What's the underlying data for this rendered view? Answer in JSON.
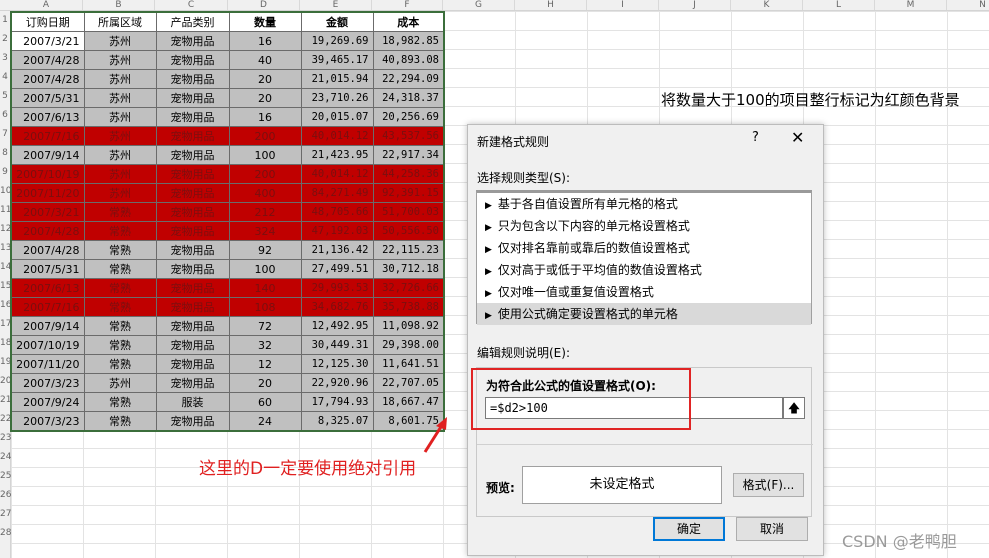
{
  "columns": [
    "A",
    "B",
    "C",
    "D",
    "E",
    "F",
    "G",
    "H",
    "I",
    "J",
    "K",
    "L",
    "M",
    "N"
  ],
  "rows": [
    "1",
    "2",
    "3",
    "4",
    "5",
    "6",
    "7",
    "8",
    "9",
    "10",
    "11",
    "12",
    "13",
    "14",
    "15",
    "16",
    "17",
    "18",
    "19",
    "20",
    "21",
    "22",
    "23",
    "24",
    "25",
    "26",
    "27",
    "28"
  ],
  "table": {
    "headers": [
      "订购日期",
      "所属区域",
      "产品类别",
      "数量",
      "金额",
      "成本"
    ],
    "records": [
      {
        "date": "2007/3/21",
        "region": "苏州",
        "category": "宠物用品",
        "qty": "16",
        "amount": "19,269.69",
        "cost": "18,982.85",
        "hl": false
      },
      {
        "date": "2007/4/28",
        "region": "苏州",
        "category": "宠物用品",
        "qty": "40",
        "amount": "39,465.17",
        "cost": "40,893.08",
        "hl": false
      },
      {
        "date": "2007/4/28",
        "region": "苏州",
        "category": "宠物用品",
        "qty": "20",
        "amount": "21,015.94",
        "cost": "22,294.09",
        "hl": false
      },
      {
        "date": "2007/5/31",
        "region": "苏州",
        "category": "宠物用品",
        "qty": "20",
        "amount": "23,710.26",
        "cost": "24,318.37",
        "hl": false
      },
      {
        "date": "2007/6/13",
        "region": "苏州",
        "category": "宠物用品",
        "qty": "16",
        "amount": "20,015.07",
        "cost": "20,256.69",
        "hl": false
      },
      {
        "date": "2007/7/16",
        "region": "苏州",
        "category": "宠物用品",
        "qty": "200",
        "amount": "40,014.12",
        "cost": "43,537.56",
        "hl": true
      },
      {
        "date": "2007/9/14",
        "region": "苏州",
        "category": "宠物用品",
        "qty": "100",
        "amount": "21,423.95",
        "cost": "22,917.34",
        "hl": false
      },
      {
        "date": "2007/10/19",
        "region": "苏州",
        "category": "宠物用品",
        "qty": "200",
        "amount": "40,014.12",
        "cost": "44,258.36",
        "hl": true
      },
      {
        "date": "2007/11/20",
        "region": "苏州",
        "category": "宠物用品",
        "qty": "400",
        "amount": "84,271.49",
        "cost": "92,391.15",
        "hl": true
      },
      {
        "date": "2007/3/21",
        "region": "常熟",
        "category": "宠物用品",
        "qty": "212",
        "amount": "48,705.66",
        "cost": "51,700.03",
        "hl": true
      },
      {
        "date": "2007/4/28",
        "region": "常熟",
        "category": "宠物用品",
        "qty": "324",
        "amount": "47,192.03",
        "cost": "50,556.50",
        "hl": true
      },
      {
        "date": "2007/4/28",
        "region": "常熟",
        "category": "宠物用品",
        "qty": "92",
        "amount": "21,136.42",
        "cost": "22,115.23",
        "hl": false
      },
      {
        "date": "2007/5/31",
        "region": "常熟",
        "category": "宠物用品",
        "qty": "100",
        "amount": "27,499.51",
        "cost": "30,712.18",
        "hl": false
      },
      {
        "date": "2007/6/13",
        "region": "常熟",
        "category": "宠物用品",
        "qty": "140",
        "amount": "29,993.53",
        "cost": "32,726.66",
        "hl": true
      },
      {
        "date": "2007/7/16",
        "region": "常熟",
        "category": "宠物用品",
        "qty": "108",
        "amount": "34,682.76",
        "cost": "35,738.88",
        "hl": true
      },
      {
        "date": "2007/9/14",
        "region": "常熟",
        "category": "宠物用品",
        "qty": "72",
        "amount": "12,492.95",
        "cost": "11,098.92",
        "hl": false
      },
      {
        "date": "2007/10/19",
        "region": "常熟",
        "category": "宠物用品",
        "qty": "32",
        "amount": "30,449.31",
        "cost": "29,398.00",
        "hl": false
      },
      {
        "date": "2007/11/20",
        "region": "常熟",
        "category": "宠物用品",
        "qty": "12",
        "amount": "12,125.30",
        "cost": "11,641.51",
        "hl": false
      },
      {
        "date": "2007/3/23",
        "region": "苏州",
        "category": "宠物用品",
        "qty": "20",
        "amount": "22,920.96",
        "cost": "22,707.05",
        "hl": false
      },
      {
        "date": "2007/9/24",
        "region": "常熟",
        "category": "服装",
        "qty": "60",
        "amount": "17,794.93",
        "cost": "18,667.47",
        "hl": false
      },
      {
        "date": "2007/3/23",
        "region": "常熟",
        "category": "宠物用品",
        "qty": "24",
        "amount": "8,325.07",
        "cost": "8,601.75",
        "hl": false
      }
    ]
  },
  "note": "将数量大于100的项目整行标记为红颜色背景",
  "caption": "这里的D一定要使用绝对引用",
  "dialog": {
    "title": "新建格式规则",
    "help": "?",
    "close": "✕",
    "rule_type_label": "选择规则类型(S):",
    "rules": [
      "基于各自值设置所有单元格的格式",
      "只为包含以下内容的单元格设置格式",
      "仅对排名靠前或靠后的数值设置格式",
      "仅对高于或低于平均值的数值设置格式",
      "仅对唯一值或重复值设置格式",
      "使用公式确定要设置格式的单元格"
    ],
    "selected_rule": 5,
    "edit_label": "编辑规则说明(E):",
    "formula_label": "为符合此公式的值设置格式(O):",
    "formula_value": "=$d2>100",
    "preview_label": "预览:",
    "preview_text": "未设定格式",
    "format_button": "格式(F)...",
    "ok_button": "确定",
    "cancel_button": "取消"
  },
  "watermark": "CSDN @老鸭胆",
  "colors": {
    "highlight": "#c00000",
    "annotation": "#e02020",
    "ok_border": "#0078d7"
  }
}
